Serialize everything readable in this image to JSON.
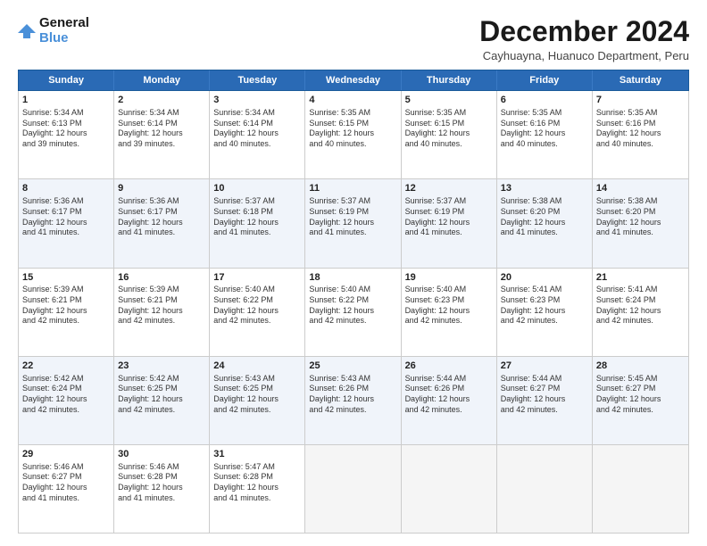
{
  "logo": {
    "line1": "General",
    "line2": "Blue"
  },
  "title": "December 2024",
  "subtitle": "Cayhuayna, Huanuco Department, Peru",
  "header_days": [
    "Sunday",
    "Monday",
    "Tuesday",
    "Wednesday",
    "Thursday",
    "Friday",
    "Saturday"
  ],
  "rows": [
    {
      "alt": false,
      "cells": [
        {
          "day": "1",
          "lines": [
            "Sunrise: 5:34 AM",
            "Sunset: 6:13 PM",
            "Daylight: 12 hours",
            "and 39 minutes."
          ]
        },
        {
          "day": "2",
          "lines": [
            "Sunrise: 5:34 AM",
            "Sunset: 6:14 PM",
            "Daylight: 12 hours",
            "and 39 minutes."
          ]
        },
        {
          "day": "3",
          "lines": [
            "Sunrise: 5:34 AM",
            "Sunset: 6:14 PM",
            "Daylight: 12 hours",
            "and 40 minutes."
          ]
        },
        {
          "day": "4",
          "lines": [
            "Sunrise: 5:35 AM",
            "Sunset: 6:15 PM",
            "Daylight: 12 hours",
            "and 40 minutes."
          ]
        },
        {
          "day": "5",
          "lines": [
            "Sunrise: 5:35 AM",
            "Sunset: 6:15 PM",
            "Daylight: 12 hours",
            "and 40 minutes."
          ]
        },
        {
          "day": "6",
          "lines": [
            "Sunrise: 5:35 AM",
            "Sunset: 6:16 PM",
            "Daylight: 12 hours",
            "and 40 minutes."
          ]
        },
        {
          "day": "7",
          "lines": [
            "Sunrise: 5:35 AM",
            "Sunset: 6:16 PM",
            "Daylight: 12 hours",
            "and 40 minutes."
          ]
        }
      ]
    },
    {
      "alt": true,
      "cells": [
        {
          "day": "8",
          "lines": [
            "Sunrise: 5:36 AM",
            "Sunset: 6:17 PM",
            "Daylight: 12 hours",
            "and 41 minutes."
          ]
        },
        {
          "day": "9",
          "lines": [
            "Sunrise: 5:36 AM",
            "Sunset: 6:17 PM",
            "Daylight: 12 hours",
            "and 41 minutes."
          ]
        },
        {
          "day": "10",
          "lines": [
            "Sunrise: 5:37 AM",
            "Sunset: 6:18 PM",
            "Daylight: 12 hours",
            "and 41 minutes."
          ]
        },
        {
          "day": "11",
          "lines": [
            "Sunrise: 5:37 AM",
            "Sunset: 6:19 PM",
            "Daylight: 12 hours",
            "and 41 minutes."
          ]
        },
        {
          "day": "12",
          "lines": [
            "Sunrise: 5:37 AM",
            "Sunset: 6:19 PM",
            "Daylight: 12 hours",
            "and 41 minutes."
          ]
        },
        {
          "day": "13",
          "lines": [
            "Sunrise: 5:38 AM",
            "Sunset: 6:20 PM",
            "Daylight: 12 hours",
            "and 41 minutes."
          ]
        },
        {
          "day": "14",
          "lines": [
            "Sunrise: 5:38 AM",
            "Sunset: 6:20 PM",
            "Daylight: 12 hours",
            "and 41 minutes."
          ]
        }
      ]
    },
    {
      "alt": false,
      "cells": [
        {
          "day": "15",
          "lines": [
            "Sunrise: 5:39 AM",
            "Sunset: 6:21 PM",
            "Daylight: 12 hours",
            "and 42 minutes."
          ]
        },
        {
          "day": "16",
          "lines": [
            "Sunrise: 5:39 AM",
            "Sunset: 6:21 PM",
            "Daylight: 12 hours",
            "and 42 minutes."
          ]
        },
        {
          "day": "17",
          "lines": [
            "Sunrise: 5:40 AM",
            "Sunset: 6:22 PM",
            "Daylight: 12 hours",
            "and 42 minutes."
          ]
        },
        {
          "day": "18",
          "lines": [
            "Sunrise: 5:40 AM",
            "Sunset: 6:22 PM",
            "Daylight: 12 hours",
            "and 42 minutes."
          ]
        },
        {
          "day": "19",
          "lines": [
            "Sunrise: 5:40 AM",
            "Sunset: 6:23 PM",
            "Daylight: 12 hours",
            "and 42 minutes."
          ]
        },
        {
          "day": "20",
          "lines": [
            "Sunrise: 5:41 AM",
            "Sunset: 6:23 PM",
            "Daylight: 12 hours",
            "and 42 minutes."
          ]
        },
        {
          "day": "21",
          "lines": [
            "Sunrise: 5:41 AM",
            "Sunset: 6:24 PM",
            "Daylight: 12 hours",
            "and 42 minutes."
          ]
        }
      ]
    },
    {
      "alt": true,
      "cells": [
        {
          "day": "22",
          "lines": [
            "Sunrise: 5:42 AM",
            "Sunset: 6:24 PM",
            "Daylight: 12 hours",
            "and 42 minutes."
          ]
        },
        {
          "day": "23",
          "lines": [
            "Sunrise: 5:42 AM",
            "Sunset: 6:25 PM",
            "Daylight: 12 hours",
            "and 42 minutes."
          ]
        },
        {
          "day": "24",
          "lines": [
            "Sunrise: 5:43 AM",
            "Sunset: 6:25 PM",
            "Daylight: 12 hours",
            "and 42 minutes."
          ]
        },
        {
          "day": "25",
          "lines": [
            "Sunrise: 5:43 AM",
            "Sunset: 6:26 PM",
            "Daylight: 12 hours",
            "and 42 minutes."
          ]
        },
        {
          "day": "26",
          "lines": [
            "Sunrise: 5:44 AM",
            "Sunset: 6:26 PM",
            "Daylight: 12 hours",
            "and 42 minutes."
          ]
        },
        {
          "day": "27",
          "lines": [
            "Sunrise: 5:44 AM",
            "Sunset: 6:27 PM",
            "Daylight: 12 hours",
            "and 42 minutes."
          ]
        },
        {
          "day": "28",
          "lines": [
            "Sunrise: 5:45 AM",
            "Sunset: 6:27 PM",
            "Daylight: 12 hours",
            "and 42 minutes."
          ]
        }
      ]
    },
    {
      "alt": false,
      "cells": [
        {
          "day": "29",
          "lines": [
            "Sunrise: 5:46 AM",
            "Sunset: 6:27 PM",
            "Daylight: 12 hours",
            "and 41 minutes."
          ]
        },
        {
          "day": "30",
          "lines": [
            "Sunrise: 5:46 AM",
            "Sunset: 6:28 PM",
            "Daylight: 12 hours",
            "and 41 minutes."
          ]
        },
        {
          "day": "31",
          "lines": [
            "Sunrise: 5:47 AM",
            "Sunset: 6:28 PM",
            "Daylight: 12 hours",
            "and 41 minutes."
          ]
        },
        {
          "day": "",
          "lines": []
        },
        {
          "day": "",
          "lines": []
        },
        {
          "day": "",
          "lines": []
        },
        {
          "day": "",
          "lines": []
        }
      ]
    }
  ]
}
